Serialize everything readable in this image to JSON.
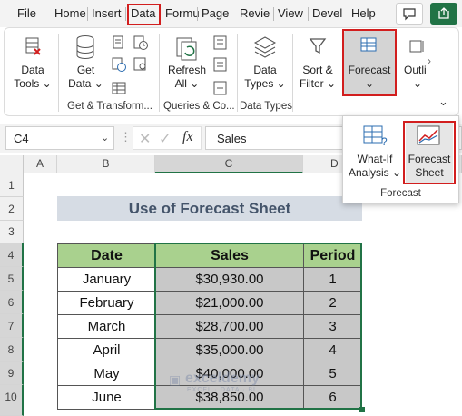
{
  "menu": {
    "items": [
      "File",
      "Home",
      "Insert",
      "Data",
      "Formu",
      "Page",
      "Revie",
      "View",
      "Devel",
      "Help"
    ],
    "active": "Data"
  },
  "ribbon": {
    "get_data": {
      "line1": "Get",
      "line2": "Data ⌄"
    },
    "data_tools": {
      "line1": "Data",
      "line2": "Tools ⌄"
    },
    "refresh_all": {
      "line1": "Refresh",
      "line2": "All ⌄"
    },
    "data_types": {
      "line1": "Data",
      "line2": "Types ⌄"
    },
    "sort_filter": {
      "line1": "Sort &",
      "line2": "Filter ⌄"
    },
    "forecast": {
      "label": "Forecast",
      "chevron": "⌄"
    },
    "outline": {
      "label": "Outli"
    },
    "groups": {
      "get_transform": "Get & Transform...",
      "queries": "Queries & Co...",
      "data_types": "Data Types"
    }
  },
  "formula_bar": {
    "name_box": "C4",
    "fx": "fx",
    "content": "Sales"
  },
  "flyout": {
    "what_if": {
      "line1": "What-If",
      "line2": "Analysis ⌄"
    },
    "forecast_sheet": {
      "line1": "Forecast",
      "line2": "Sheet"
    },
    "group_label": "Forecast"
  },
  "grid": {
    "columns": [
      "A",
      "B",
      "C",
      "D"
    ],
    "rows": [
      "1",
      "2",
      "3",
      "4",
      "5",
      "6",
      "7",
      "8",
      "9",
      "10"
    ],
    "title": "Use of Forecast Sheet",
    "headers": [
      "Date",
      "Sales",
      "Period"
    ],
    "data": [
      [
        "January",
        "$30,930.00",
        "1"
      ],
      [
        "February",
        "$21,000.00",
        "2"
      ],
      [
        "March",
        "$28,700.00",
        "3"
      ],
      [
        "April",
        "$35,000.00",
        "4"
      ],
      [
        "May",
        "$40,000.00",
        "5"
      ],
      [
        "June",
        "$38,850.00",
        "6"
      ]
    ]
  },
  "watermark": {
    "name": "exceldemy",
    "tagline": "EXCEL · DATA · BI"
  },
  "colors": {
    "header_green": "#a9d18e",
    "title_band": "#d6dce4",
    "selection_grey": "#c8c8c8",
    "accent_red": "#d21e1e",
    "excel_green": "#217346"
  }
}
